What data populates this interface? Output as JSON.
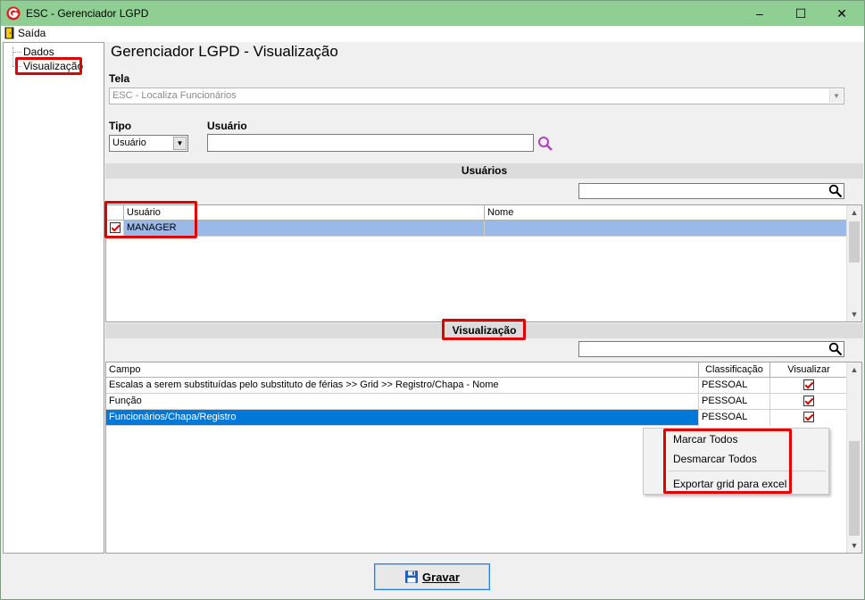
{
  "window": {
    "title": "ESC - Gerenciador LGPD",
    "minimize": "–",
    "maximize": "☐",
    "close": "✕"
  },
  "menu": {
    "exit_label": "Saída"
  },
  "nav": {
    "items": [
      "Dados",
      "Visualização"
    ]
  },
  "page": {
    "title": "Gerenciador LGPD - Visualização",
    "tela_label": "Tela",
    "tela_value": "ESC - Localiza Funcionários",
    "tipo_label": "Tipo",
    "tipo_value": "Usuário",
    "usuario_label": "Usuário",
    "usuario_value": ""
  },
  "users_section": {
    "title": "Usuários",
    "columns": [
      "Usuário",
      "Nome"
    ],
    "rows": [
      {
        "checked": true,
        "usuario": "MANAGER",
        "nome": ""
      }
    ]
  },
  "view_section": {
    "title": "Visualização",
    "columns": [
      "Campo",
      "Classificação",
      "Visualizar"
    ],
    "rows": [
      {
        "campo": "Escalas a serem substituídas pelo substituto de férias >> Grid >> Registro/Chapa - Nome",
        "classificacao": "PESSOAL",
        "visualizar": true
      },
      {
        "campo": "Função",
        "classificacao": "PESSOAL",
        "visualizar": true
      },
      {
        "campo": "Funcionários/Chapa/Registro",
        "classificacao": "PESSOAL",
        "visualizar": true
      }
    ]
  },
  "context_menu": {
    "items": [
      "Marcar Todos",
      "Desmarcar Todos",
      "Exportar grid para excel"
    ]
  },
  "footer": {
    "save_label": "Gravar"
  },
  "colors": {
    "titlebar": "#8fcf93",
    "selection_blue": "#0078d7",
    "selection_light": "#9ab8e8",
    "annotation_red": "#e00000"
  }
}
